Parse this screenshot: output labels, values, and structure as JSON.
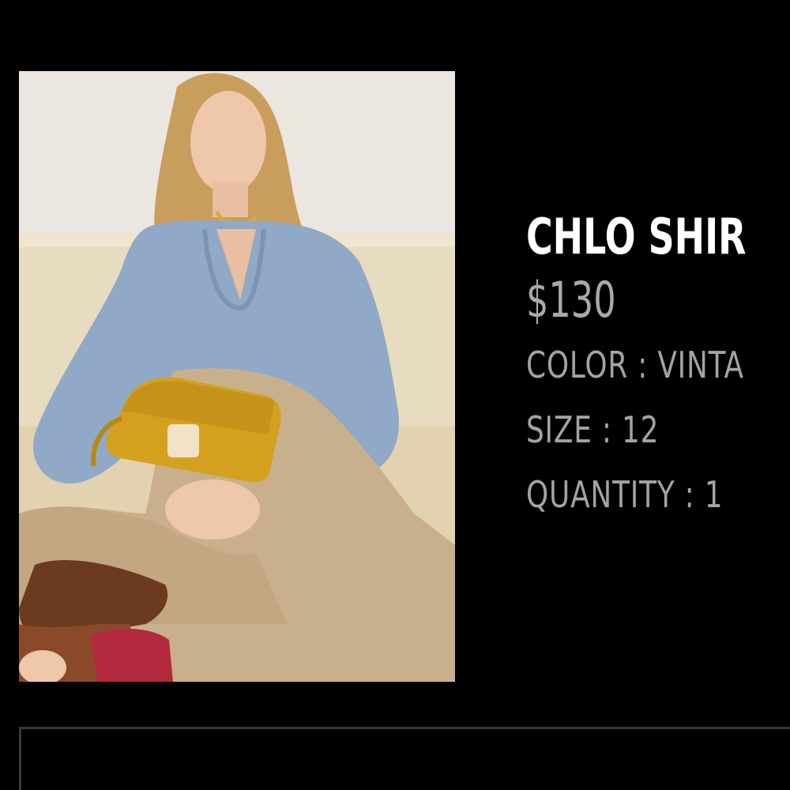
{
  "product": {
    "title": "CHLO SHIR",
    "price": "$130",
    "color_line": "COLOR : VINTA",
    "size_line": "SIZE : 12",
    "quantity_line": "QUANTITY : 1"
  },
  "image": {
    "alt": "Woman in a blue ruffled blouse and tan trousers holding a mustard yellow handbag"
  },
  "colors": {
    "background": "#000000",
    "title": "#ffffff",
    "secondary_text": "#a9a9a9",
    "blouse": "#8fa9c6",
    "bag": "#d4a11f",
    "trousers": "#c9b08c"
  }
}
